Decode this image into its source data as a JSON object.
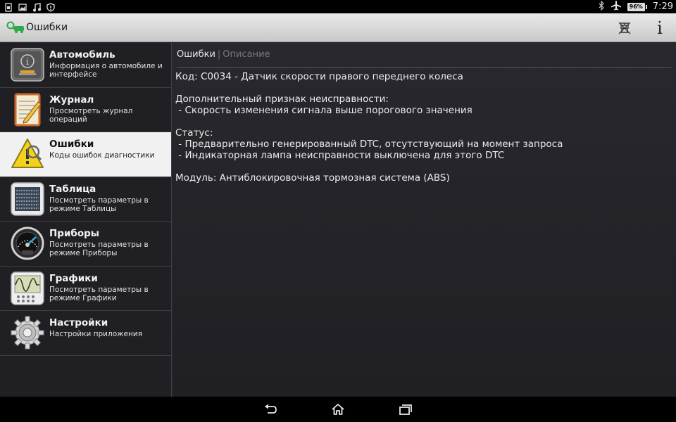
{
  "status_bar": {
    "battery": "96%",
    "time": "7:29"
  },
  "action_bar": {
    "title": "Ошибки",
    "info_label": "i"
  },
  "sidebar": {
    "items": [
      {
        "title": "Автомобиль",
        "subtitle": "Информация о автомобиле и интерфейсе",
        "icon": "car-info-icon"
      },
      {
        "title": "Журнал",
        "subtitle": "Просмотреть журнал операций",
        "icon": "journal-icon"
      },
      {
        "title": "Ошибки",
        "subtitle": "Коды ошибок диагностики",
        "icon": "warning-icon",
        "selected": true
      },
      {
        "title": "Таблица",
        "subtitle": "Посмотреть параметры в режиме Таблицы",
        "icon": "table-icon"
      },
      {
        "title": "Приборы",
        "subtitle": "Посмотреть параметры в режиме Приборы",
        "icon": "gauge-icon"
      },
      {
        "title": "Графики",
        "subtitle": "Посмотреть параметры в режиме Графики",
        "icon": "graph-icon"
      },
      {
        "title": "Настройки",
        "subtitle": "Настройки приложения",
        "icon": "settings-gear-icon"
      }
    ]
  },
  "content": {
    "tab_active": "Ошибки",
    "tab_separator": "|",
    "tab_inactive": "Описание",
    "code_line": "Код: C0034 - Датчик скорости правого переднего колеса",
    "extra_heading": "Дополнительный признак неисправности:",
    "extra_line1": " - Скорость изменения сигнала выше порогового значения",
    "status_heading": "Статус:",
    "status_line1": " - Предварительно генерированный DTC, отсутствующий на момент запроса",
    "status_line2": " - Индикаторная лампа неисправности выключена для этого DTC",
    "module_line": "Модуль: Антиблокировочная тормозная система (ABS)"
  },
  "colors": {
    "background": "#26262b",
    "sidebar": "#202024",
    "selected_item": "#f1f1f1",
    "action_bar": "#d8d8d8",
    "warning_yellow": "#f3d21a",
    "logo_green": "#2fa84a"
  }
}
